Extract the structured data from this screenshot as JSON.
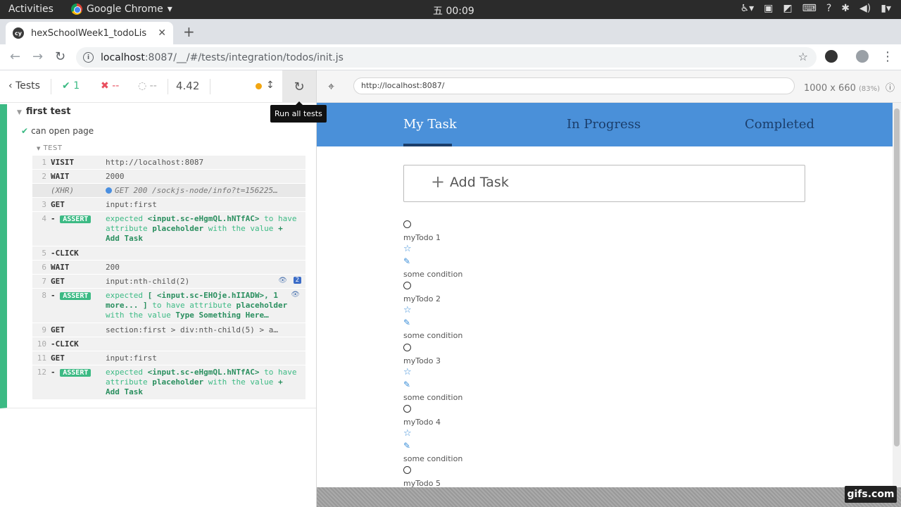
{
  "os_bar": {
    "activities": "Activities",
    "app_name": "Google Chrome",
    "clock": "五 00:09"
  },
  "browser": {
    "tab_title": "hexSchoolWeek1_todoLis",
    "url_host": "localhost",
    "url_path": ":8087/__/#/tests/integration/todos/init.js"
  },
  "reporter": {
    "back_label": "Tests",
    "passed": "1",
    "failed": "--",
    "pending": "--",
    "duration": "4.42",
    "tooltip": "Run all tests",
    "suite_title": "first test",
    "test_title": "can open page",
    "test_label": "TEST",
    "commands": [
      {
        "n": "1",
        "name": "VISIT",
        "msg": "http://localhost:8087"
      },
      {
        "n": "2",
        "name": "WAIT",
        "msg": "2000"
      },
      {
        "n": "",
        "name": "(XHR)",
        "msg": "GET 200 /sockjs-node/info?t=156225…"
      },
      {
        "n": "3",
        "name": "GET",
        "msg": "input:first"
      },
      {
        "n": "4",
        "name": "ASSERT",
        "pre": "expected ",
        "b1": "<input.sc-eHgmQL.hNTfAC>",
        "mid": " to have attribute ",
        "b2": "placeholder",
        "mid2": " with the value ",
        "b3": "+ Add Task"
      },
      {
        "n": "5",
        "name": "-CLICK",
        "msg": ""
      },
      {
        "n": "6",
        "name": "WAIT",
        "msg": "200"
      },
      {
        "n": "7",
        "name": "GET",
        "msg": "input:nth-child(2)",
        "count": "2"
      },
      {
        "n": "8",
        "name": "ASSERT",
        "pre": "expected ",
        "b1": "[ <input.sc-EHOje.hIIADW>, 1 more... ]",
        "mid": " to have attribute ",
        "b2": "placeholder",
        "mid2": " with the value ",
        "b3": "Type Something Here…"
      },
      {
        "n": "9",
        "name": "GET",
        "msg": "section:first > div:nth-child(5) > a…"
      },
      {
        "n": "10",
        "name": "-CLICK",
        "msg": ""
      },
      {
        "n": "11",
        "name": "GET",
        "msg": "input:first"
      },
      {
        "n": "12",
        "name": "ASSERT",
        "pre": "expected ",
        "b1": "<input.sc-eHgmQL.hNTfAC>",
        "mid": " to have attribute ",
        "b2": "placeholder",
        "mid2": " with the value ",
        "b3": "+ Add Task"
      }
    ]
  },
  "aut": {
    "url": "http://localhost:8087/",
    "dims": "1000 x 660",
    "scale": "(83%)",
    "nav": [
      "My Task",
      "In Progress",
      "Completed"
    ],
    "add_task": "Add Task",
    "todos": [
      {
        "name": "myTodo 1",
        "cond": "some condition"
      },
      {
        "name": "myTodo 2",
        "cond": "some condition"
      },
      {
        "name": "myTodo 3",
        "cond": "some condition"
      },
      {
        "name": "myTodo 4",
        "cond": "some condition"
      },
      {
        "name": "myTodo 5",
        "cond": ""
      }
    ]
  },
  "watermark": "gifs.com",
  "colors": {
    "pass": "#3cba84",
    "fail": "#e94f5f",
    "nav_bg": "#4a90d9",
    "nav_text": "#1b3e6b"
  }
}
